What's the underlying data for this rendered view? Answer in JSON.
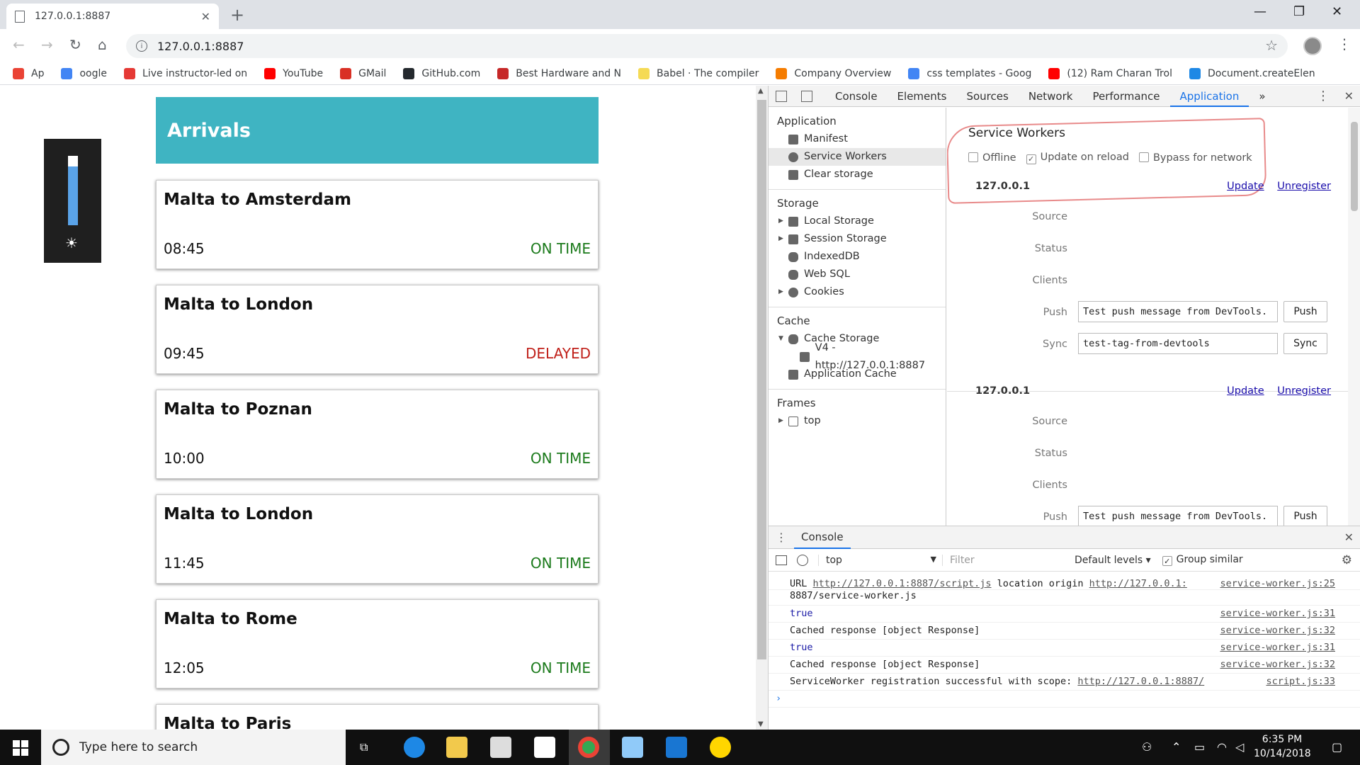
{
  "browser": {
    "tab_title": "127.0.0.1:8887",
    "tab_close": "✕",
    "new_tab": "+",
    "url": "127.0.0.1:8887",
    "bookmarks": [
      {
        "label": "Ap",
        "icon": "apps-icon",
        "color": "#ea4335"
      },
      {
        "label": "oogle",
        "icon": "google-icon",
        "color": "#4285f4"
      },
      {
        "label": "Live instructor-led on",
        "icon": "a-icon",
        "color": "#e53935"
      },
      {
        "label": "YouTube",
        "icon": "youtube-icon",
        "color": "#ff0000"
      },
      {
        "label": "GMail",
        "icon": "gmail-icon",
        "color": "#d93025"
      },
      {
        "label": "GitHub.com",
        "icon": "github-icon",
        "color": "#24292e"
      },
      {
        "label": "Best Hardware and N",
        "icon": "shield-icon",
        "color": "#c62828"
      },
      {
        "label": "Babel · The compiler",
        "icon": "babel-icon",
        "color": "#f5da55"
      },
      {
        "label": "Company Overview",
        "icon": "company-icon",
        "color": "#f57c00"
      },
      {
        "label": "css templates - Goog",
        "icon": "google-icon",
        "color": "#4285f4"
      },
      {
        "label": "(12) Ram Charan Trol",
        "icon": "youtube-icon",
        "color": "#ff0000"
      },
      {
        "label": "Document.createElen",
        "icon": "mdn-icon",
        "color": "#1e88e5"
      }
    ]
  },
  "page": {
    "header": "Arrivals",
    "flights": [
      {
        "route": "Malta to Amsterdam",
        "time": "08:45",
        "status": "ON TIME",
        "status_color": "#1b7a1b"
      },
      {
        "route": "Malta to London",
        "time": "09:45",
        "status": "DELAYED",
        "status_color": "#c0201a"
      },
      {
        "route": "Malta to Poznan",
        "time": "10:00",
        "status": "ON TIME",
        "status_color": "#1b7a1b"
      },
      {
        "route": "Malta to London",
        "time": "11:45",
        "status": "ON TIME",
        "status_color": "#1b7a1b"
      },
      {
        "route": "Malta to Rome",
        "time": "12:05",
        "status": "ON TIME",
        "status_color": "#1b7a1b"
      },
      {
        "route": "Malta to Paris",
        "time": "",
        "status": "",
        "status_color": "#1b7a1b"
      }
    ],
    "brightness_level": 0.85
  },
  "devtools": {
    "tabs": [
      "Console",
      "Elements",
      "Sources",
      "Network",
      "Performance",
      "Application"
    ],
    "more": "»",
    "sidebar": {
      "application_label": "Application",
      "application_items": [
        "Manifest",
        "Service Workers",
        "Clear storage"
      ],
      "storage_label": "Storage",
      "storage_items": [
        "Local Storage",
        "Session Storage",
        "IndexedDB",
        "Web SQL",
        "Cookies"
      ],
      "cache_label": "Cache",
      "cache_items": [
        "Cache Storage",
        "V4 - http://127.0.0.1:8887",
        "Application Cache"
      ],
      "frames_label": "Frames",
      "frames_items": [
        "top"
      ]
    },
    "service_workers": {
      "title": "Service Workers",
      "offline": "Offline",
      "update_on_reload": "Update on reload",
      "bypass": "Bypass for network",
      "host": "127.0.0.1",
      "update": "Update",
      "unregister": "Unregister",
      "source": "Source",
      "status": "Status",
      "clients": "Clients",
      "push": "Push",
      "push_value": "Test push message from DevTools.",
      "push_btn": "Push",
      "sync": "Sync",
      "sync_value": "test-tag-from-devtools",
      "sync_btn": "Sync",
      "push_partial": "Test push message from DevTools."
    },
    "console": {
      "drawer_tab": "Console",
      "context": "top",
      "filter_placeholder": "Filter",
      "levels": "Default levels ▾",
      "group_similar": "Group similar",
      "lines": [
        {
          "text_a": "URL ",
          "link": "http://127.0.0.1:8887/script.js",
          "text_b": " location origin ",
          "link2": "http://127.0.0.1:",
          "src": "service-worker.js:25"
        },
        {
          "text": "8887/service-worker.js",
          "src": ""
        },
        {
          "text": "true",
          "src": "service-worker.js:31"
        },
        {
          "text": "Cached response [object Response]",
          "src": "service-worker.js:32"
        },
        {
          "text": "true",
          "src": "service-worker.js:31"
        },
        {
          "text": "Cached response [object Response]",
          "src": "service-worker.js:32"
        },
        {
          "text": "ServiceWorker registration successful with scope:",
          "link": "http://127.0.0.1:8887/",
          "src": "script.js:33"
        }
      ],
      "prompt": "›"
    }
  },
  "taskbar": {
    "search_placeholder": "Type here to search",
    "time": "6:35 PM",
    "date": "10/14/2018"
  }
}
